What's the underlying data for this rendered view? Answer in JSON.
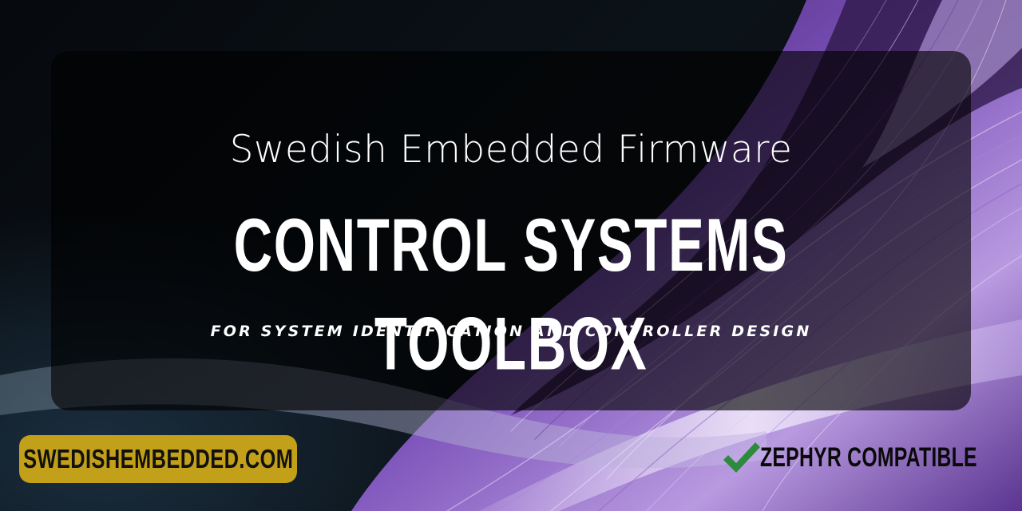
{
  "banner": {
    "subtitle": "Swedish Embedded Firmware",
    "title": "CONTROL SYSTEMS TOOLBOX",
    "tagline": "FOR SYSTEM IDENTIFICATION AND CONTROLLER DESIGN",
    "website_label": "SWEDISHEMBEDDED.COM",
    "compatibility_label": "ZEPHYR COMPATIBLE",
    "compatibility_icon": "checkmark-icon"
  },
  "colors": {
    "background": "#06090d",
    "wave_purple": "#9b6fd6",
    "wave_light": "#d9c8f0",
    "badge_gold": "#c2a01a",
    "check_green": "#2e8b3e",
    "text_white": "#ffffff"
  }
}
